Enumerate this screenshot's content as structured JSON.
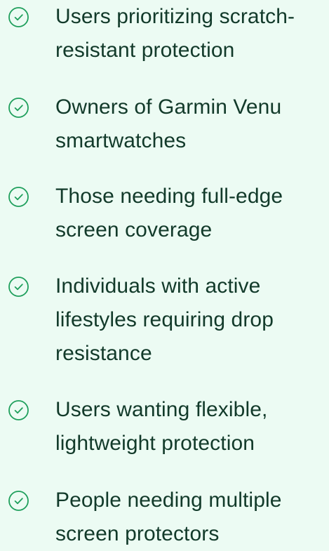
{
  "accent_color": "#1f9f5c",
  "text_color": "#123a2a",
  "background_color": "#ecfbf3",
  "items": [
    {
      "icon": "check-circle-icon",
      "label": "Users prioritizing scratch-resistant protection",
      "lines": [
        "Users prioritizing scratch-",
        "resistant protection"
      ]
    },
    {
      "icon": "check-circle-icon",
      "label": "Owners of Garmin Venu smartwatches",
      "lines": [
        "Owners of Garmin Venu",
        "smartwatches"
      ]
    },
    {
      "icon": "check-circle-icon",
      "label": "Those needing full-edge screen coverage",
      "lines": [
        "Those needing full-edge",
        "screen coverage"
      ]
    },
    {
      "icon": "check-circle-icon",
      "label": "Individuals with active lifestyles requiring drop resistance",
      "lines": [
        "Individuals with active",
        "lifestyles requiring drop",
        "resistance"
      ]
    },
    {
      "icon": "check-circle-icon",
      "label": "Users wanting flexible, lightweight protection",
      "lines": [
        "Users wanting flexible,",
        "lightweight protection"
      ]
    },
    {
      "icon": "check-circle-icon",
      "label": "People needing multiple screen protectors",
      "lines": [
        "People needing multiple",
        "screen protectors"
      ]
    }
  ]
}
